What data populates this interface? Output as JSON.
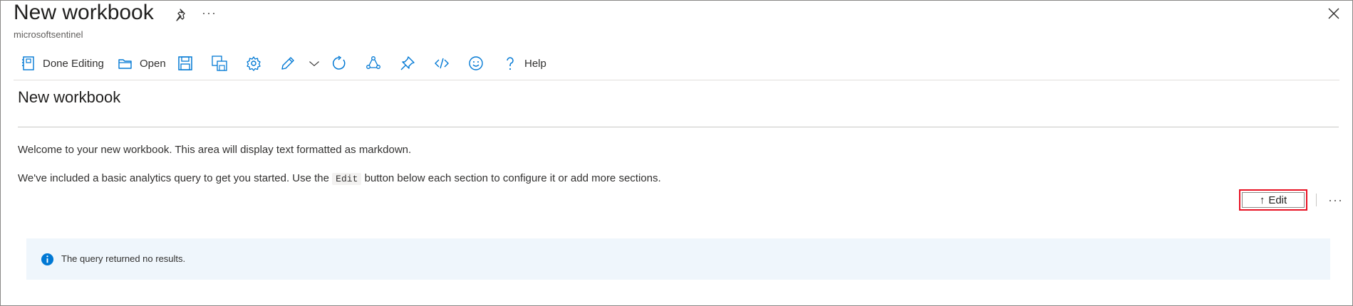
{
  "header": {
    "title": "New workbook",
    "subtitle": "microsoftsentinel",
    "more_label": "···"
  },
  "toolbar": {
    "done_editing_label": "Done Editing",
    "open_label": "Open",
    "help_label": "Help",
    "icons": [
      "edit-document-icon",
      "folder-open-icon",
      "save-icon",
      "save-as-icon",
      "gear-icon",
      "pencil-icon",
      "chevron-down-icon",
      "refresh-icon",
      "share-icon",
      "pin-icon",
      "code-icon",
      "smiley-icon",
      "help-icon"
    ]
  },
  "section": {
    "title": "New workbook",
    "para1": "Welcome to your new workbook. This area will display text formatted as markdown.",
    "para2_before": "We've included a basic analytics query to get you started. Use the",
    "para2_code": "Edit",
    "para2_after": "button below each section to configure it or add more sections.",
    "edit_button_label": "Edit",
    "edit_arrow": "↑",
    "more_label": "···"
  },
  "info": {
    "message": "The query returned no results."
  },
  "colors": {
    "accent": "#0078d4",
    "highlight_border": "#e81123",
    "info_background": "#eff6fc"
  }
}
